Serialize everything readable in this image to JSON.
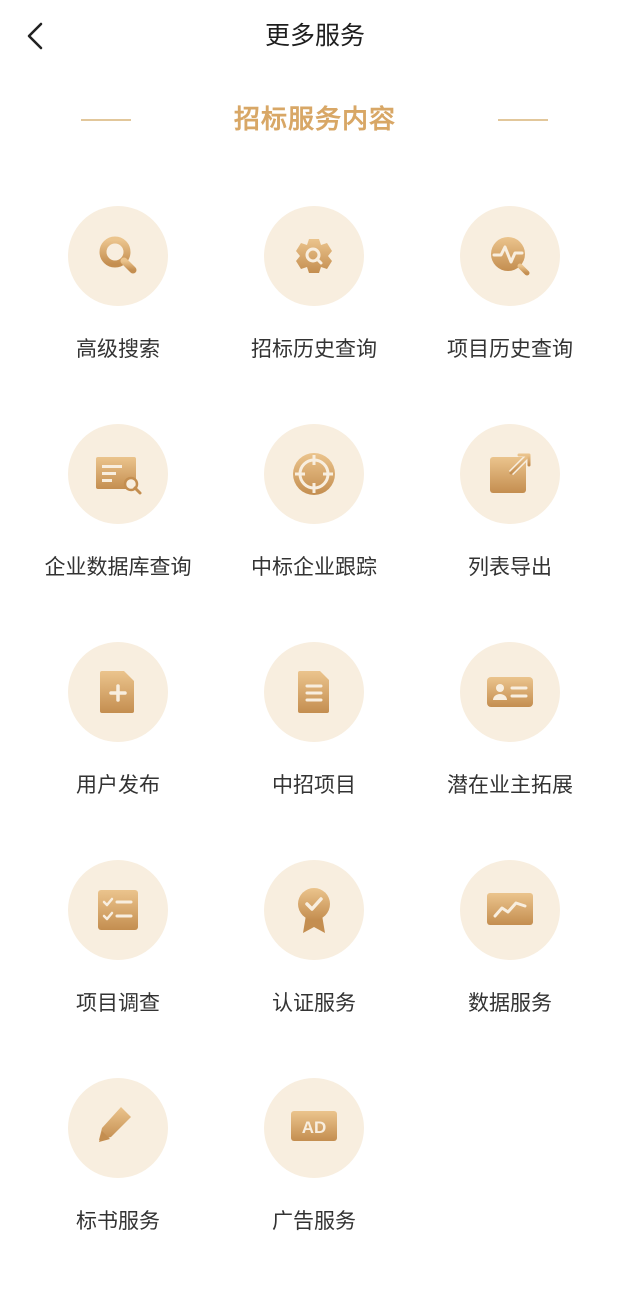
{
  "nav": {
    "title": "更多服务"
  },
  "section": {
    "title": "招标服务内容"
  },
  "colors": {
    "accent": "#d8a766",
    "icon_bg": "#f8eedf",
    "icon_fill_light": "#e7bd83",
    "icon_fill_dark": "#c79355"
  },
  "services": [
    {
      "label": "高级搜索",
      "icon": "search-icon"
    },
    {
      "label": "招标历史查询",
      "icon": "gear-search-icon"
    },
    {
      "label": "项目历史查询",
      "icon": "pulse-search-icon"
    },
    {
      "label": "企业数据库查询",
      "icon": "database-search-icon"
    },
    {
      "label": "中标企业跟踪",
      "icon": "target-icon"
    },
    {
      "label": "列表导出",
      "icon": "export-icon"
    },
    {
      "label": "用户发布",
      "icon": "add-document-icon"
    },
    {
      "label": "中招项目",
      "icon": "document-icon"
    },
    {
      "label": "潜在业主拓展",
      "icon": "id-card-icon"
    },
    {
      "label": "项目调查",
      "icon": "checklist-icon"
    },
    {
      "label": "认证服务",
      "icon": "badge-icon"
    },
    {
      "label": "数据服务",
      "icon": "chart-icon"
    },
    {
      "label": "标书服务",
      "icon": "pen-icon"
    },
    {
      "label": "广告服务",
      "icon": "ad-icon"
    }
  ],
  "ad_icon_text": "AD"
}
